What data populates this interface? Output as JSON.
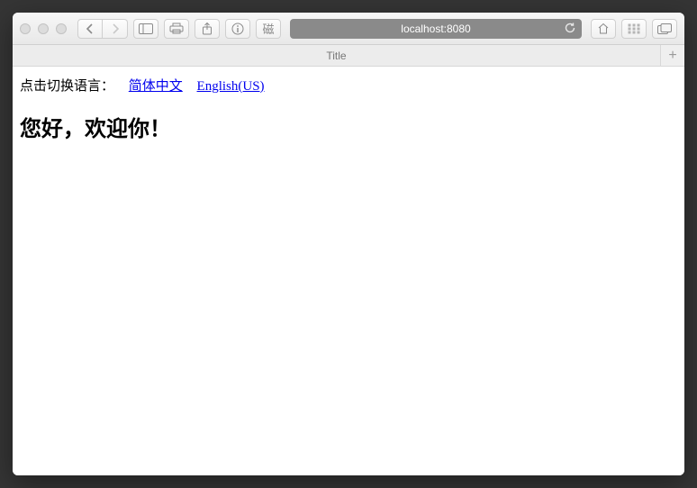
{
  "toolbar": {
    "address": "localhost:8080",
    "magic_label": "磁"
  },
  "tabs": {
    "title": "Title",
    "new_tab": "+"
  },
  "page": {
    "prompt": "点击切换语言：",
    "languages": [
      {
        "label": "简体中文"
      },
      {
        "label": "English(US)"
      }
    ],
    "heading": "您好，欢迎你！"
  }
}
